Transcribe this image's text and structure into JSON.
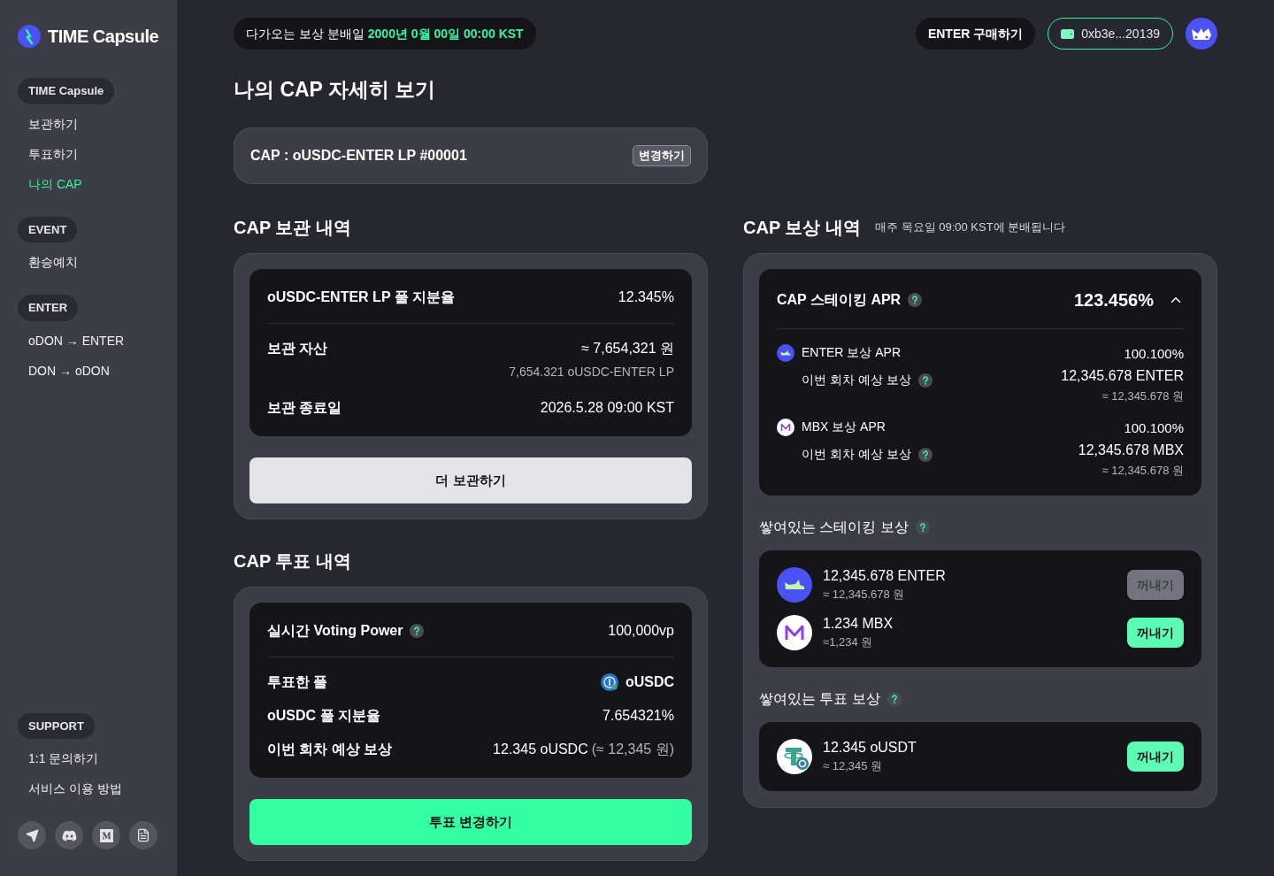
{
  "sidebar": {
    "logo": "TIME Capsule",
    "groups": [
      {
        "header": "TIME Capsule",
        "items": [
          {
            "label": "보관하기",
            "selected": false
          },
          {
            "label": "투표하기",
            "selected": false
          },
          {
            "label": "나의 CAP",
            "selected": true
          }
        ]
      },
      {
        "header": "EVENT",
        "items": [
          {
            "label": "환승예치",
            "selected": false
          }
        ]
      },
      {
        "header": "ENTER",
        "items": [
          {
            "label": "oDON → ENTER",
            "selected": false
          },
          {
            "label": "DON → oDON",
            "selected": false
          }
        ]
      }
    ],
    "support": {
      "header": "SUPPORT",
      "items": [
        {
          "label": "1:1 문의하기",
          "selected": false
        },
        {
          "label": "서비스 이용 방법",
          "selected": false
        }
      ]
    },
    "social": [
      {
        "kind": "telegram"
      },
      {
        "kind": "discord"
      },
      {
        "kind": "medium"
      },
      {
        "kind": "docs"
      }
    ]
  },
  "topbar": {
    "notice": "다가오는 보상 분배일",
    "notice_date": "2000년 0월 00일 00:00 KST",
    "buy_button": "ENTER 구매하기",
    "wallet": "0xb3e...20139"
  },
  "page_title": "나의 CAP 자세히 보기",
  "cap_selector": {
    "label": "CAP : oUSDC-ENTER LP #00001",
    "button": "변경하기"
  },
  "holding": {
    "title": "CAP 보관 내역",
    "rows": [
      {
        "label": "oUSDC-ENTER LP 풀 지분율",
        "value": "12.345%"
      },
      {
        "label": "보관 자산",
        "value": "≈ 7,654,321 원",
        "sub": "7,654.321 oUSDC-ENTER LP"
      },
      {
        "label": "보관 종료일",
        "value": "2026.5.28 09:00 KST"
      }
    ],
    "button": "더 보관하기"
  },
  "voting": {
    "title": "CAP 투표 내역",
    "rows": [
      {
        "label": "실시간 Voting Power",
        "help": true,
        "value": "100,000vp"
      },
      {
        "label": "투표한 풀",
        "value": "oUSDC",
        "kind": "usdc"
      },
      {
        "label": "oUSDC 풀 지분율",
        "value": "7.654321%"
      },
      {
        "label": "이번 회차 예상 보상",
        "value": "12.345 oUSDC",
        "value_muted": "(≈ 12,345 원)"
      }
    ],
    "button": "투표 변경하기"
  },
  "rewards": {
    "title": "CAP 보상 내역",
    "note": "매주 목요일 09:00 KST에 분배됩니다",
    "apr": {
      "label": "CAP 스테이킹 APR",
      "help": true,
      "value": "123.456%",
      "expanded": true,
      "items": [
        {
          "kind": "enter",
          "label": "ENTER 보상 APR",
          "value": "100.100%",
          "sub_label": "이번 회차 예상 보상",
          "sub_help": true,
          "amount": "12,345.678 ENTER",
          "krw": "≈ 12,345.678 원"
        },
        {
          "kind": "mbx",
          "label": "MBX 보상 APR",
          "value": "100.100%",
          "sub_label": "이번 회차 예상 보상",
          "sub_help": true,
          "amount": "12,345.678 MBX",
          "krw": "≈ 12,345.678 원"
        }
      ]
    },
    "sections": [
      {
        "title": "쌓여있는 스테이킹 보상",
        "help": true,
        "items": [
          {
            "kind": "enter",
            "amount": "12,345.678 ENTER",
            "krw": "≈ 12,345.678 원",
            "button": "꺼내기",
            "disabled": true
          },
          {
            "kind": "mbx",
            "amount": "1.234 MBX",
            "krw": "≈1,234 원",
            "button": "꺼내기",
            "disabled": false
          }
        ]
      },
      {
        "title": "쌓여있는 투표 보상",
        "help": true,
        "items": [
          {
            "kind": "usdt",
            "amount": "12.345 oUSDT",
            "krw": "≈ 12,345 원",
            "button": "꺼내기",
            "disabled": false
          }
        ]
      }
    ]
  }
}
